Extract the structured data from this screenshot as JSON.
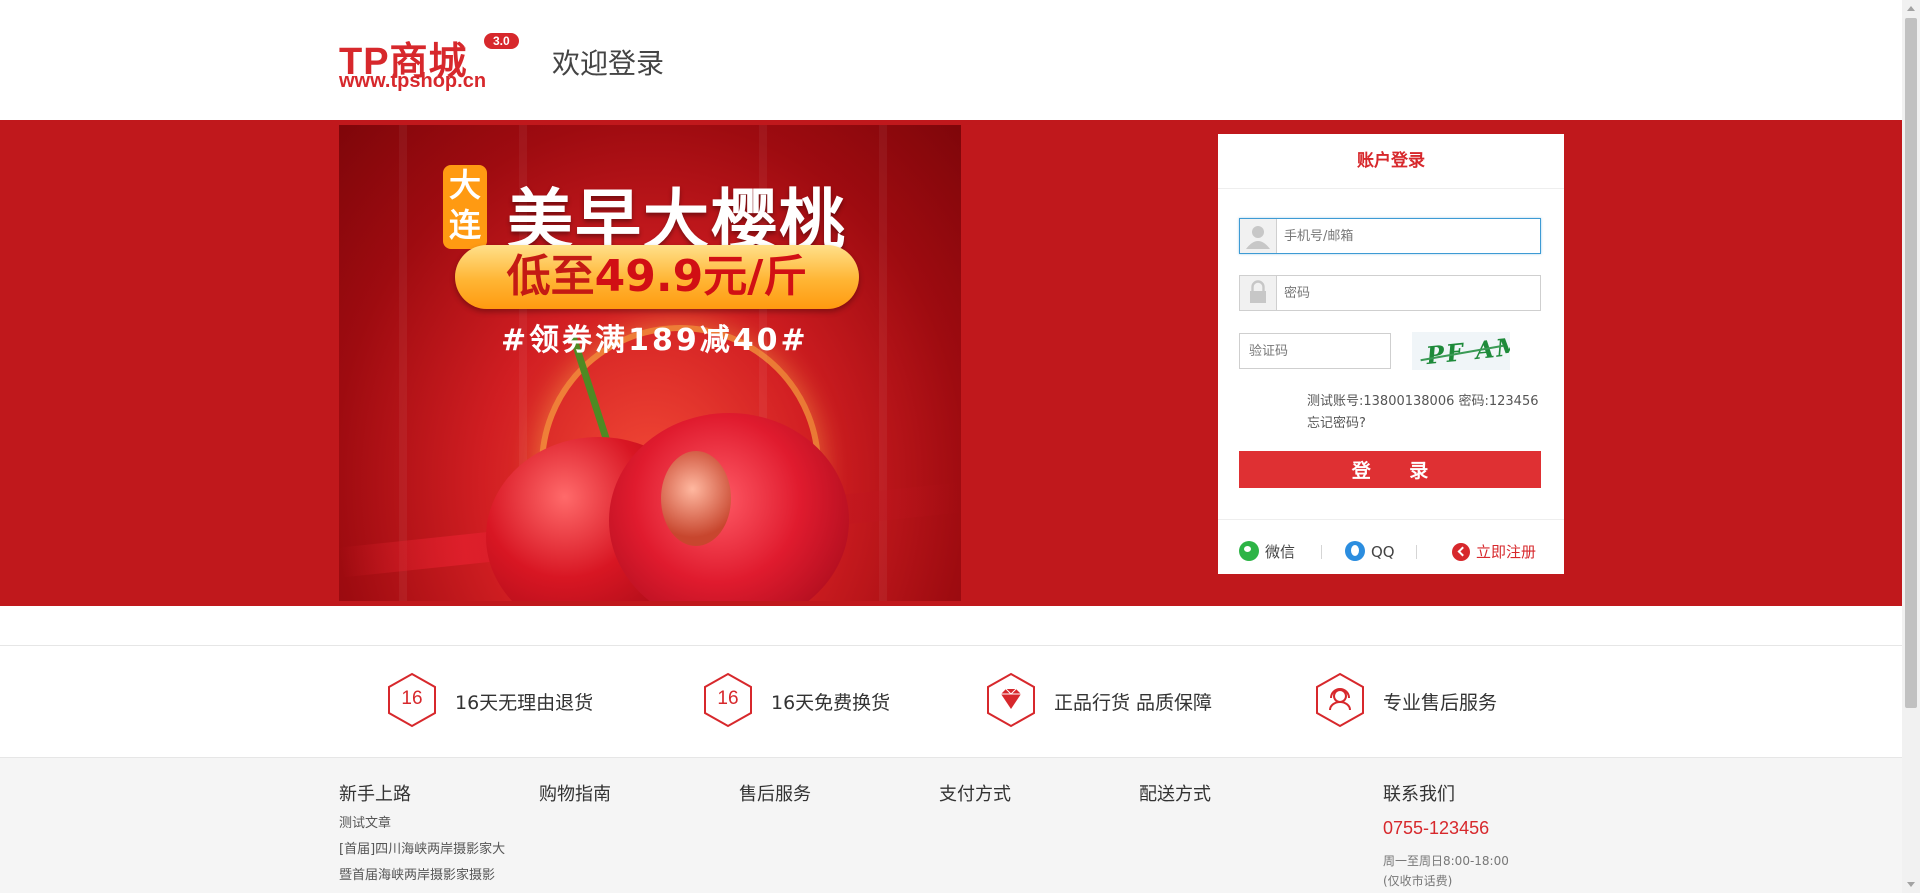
{
  "header": {
    "logo_text": "TP商城",
    "logo_version": "3.0",
    "logo_url": "www.tpshop.cn",
    "welcome": "欢迎登录"
  },
  "banner": {
    "tag": "大连",
    "title": "美早大樱桃",
    "price_prefix": "低至",
    "price": "49.9元/斤",
    "coupon": "#领券满189减40#"
  },
  "login": {
    "title": "账户登录",
    "username_placeholder": "手机号/邮箱",
    "password_placeholder": "密码",
    "captcha_placeholder": "验证码",
    "captcha_text": "PF AM",
    "test_account": "测试账号:13800138006 密码:123456",
    "forgot": "忘记密码?",
    "submit": "登 录",
    "wechat": "微信",
    "qq": "QQ",
    "register": "立即注册"
  },
  "services": [
    {
      "icon": "hexagon-16-icon",
      "badge": "16",
      "label": "16天无理由退货"
    },
    {
      "icon": "hexagon-16-icon",
      "badge": "16",
      "label": "16天免费换货"
    },
    {
      "icon": "diamond-icon",
      "badge": "",
      "label": "正品行货 品质保障"
    },
    {
      "icon": "headset-service-icon",
      "badge": "",
      "label": "专业售后服务"
    }
  ],
  "footer": {
    "col1_title": "新手上路",
    "col1_links": [
      "测试文章",
      "[首届]四川海峡两岸摄影家大",
      "暨首届海峡两岸摄影家摄影"
    ],
    "col2_title": "购物指南",
    "col3_title": "售后服务",
    "col4_title": "支付方式",
    "col5_title": "配送方式",
    "contact_title": "联系我们",
    "phone": "0755-123456",
    "hours": "周一至周日8:00-18:00",
    "hours_note": "(仅收市话费)"
  },
  "colors": {
    "brand_red": "#d7282c",
    "band_red": "#c0181c",
    "button_red": "#df3033"
  }
}
